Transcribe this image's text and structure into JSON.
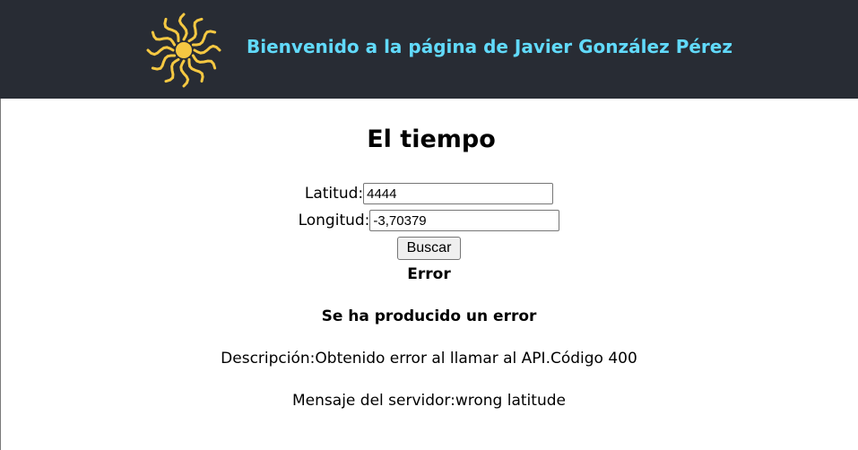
{
  "header": {
    "logo": "sun-logo",
    "title": "Bienvenido a la página de Javier González Pérez",
    "bg_color": "#282c34",
    "title_color": "#61dafb",
    "logo_color": "#f5c842"
  },
  "main": {
    "title": "El tiempo",
    "form": {
      "latitude_label": "Latitud:",
      "latitude_value": "4444",
      "longitude_label": "Longitud:",
      "longitude_value": "-3,70379",
      "search_label": "Buscar"
    },
    "error": {
      "heading": "Error",
      "subheading": "Se ha producido un error",
      "description_label": "Descripción:",
      "description_text": "Obtenido error al llamar al API.Código 400",
      "server_label": "Mensaje del servidor:",
      "server_text": "wrong latitude"
    }
  }
}
